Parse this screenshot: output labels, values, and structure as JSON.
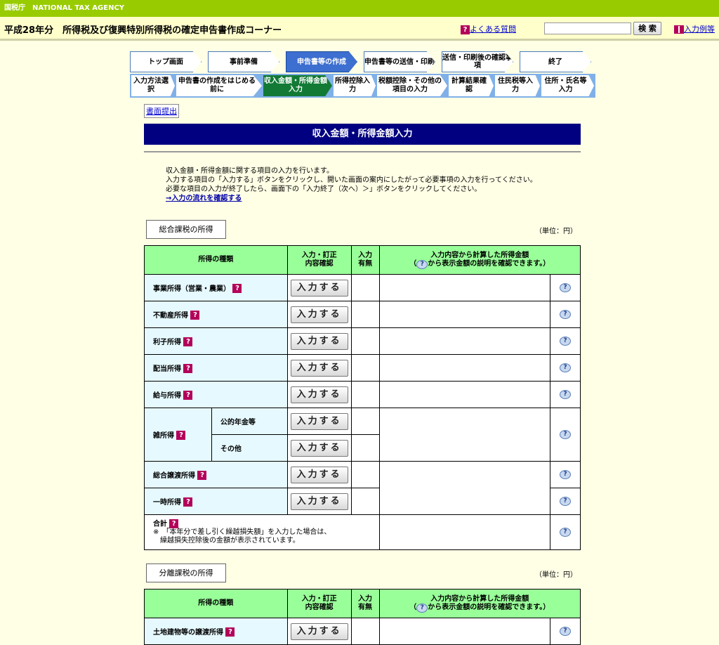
{
  "header": {
    "agency": "国税庁　NATIONAL TAX AGENCY",
    "title": "平成28年分　所得税及び復興特別所得税の確定申告書作成コーナー",
    "faq_label": "よくある質問",
    "search_button": "検 索",
    "search_value": "",
    "example_label": "入力例等"
  },
  "steps": [
    "トップ画面",
    "事前準備",
    "申告書等の作成",
    "申告書等の送信・印刷",
    "送信・印刷後の確認事項",
    "終了"
  ],
  "substeps": [
    "入力方法選択",
    "申告書の作成をはじめる前に",
    "収入金額・所得金額入力",
    "所得控除入力",
    "税額控除・その他の項目の入力",
    "計算結果確認",
    "住民税等入力",
    "住所・氏名等入力"
  ],
  "paper_button": "書面提出",
  "heading": "収入金額・所得金額入力",
  "intro": {
    "line1": "収入金額・所得金額に関する項目の入力を行います。",
    "line2": "入力する項目の「入力する」ボタンをクリックし、開いた画面の案内にしたがって必要事項の入力を行ってください。",
    "line3": "必要な項目の入力が終了したら、画面下の「入力終了（次へ）＞」ボタンをクリックしてください。",
    "link": "→入力の流れを確認する"
  },
  "section1": {
    "title": "総合課税の所得",
    "unit": "（単位：円）",
    "headers": {
      "type": "所得の種類",
      "confirm": "入力・訂正\n内容確認",
      "has_input": "入力\n有無",
      "amount": "入力内容から計算した所得金額\n（  から表示金額の説明を確認できます。）"
    },
    "rows": {
      "business": "事業所得（営業・農業）",
      "real_estate": "不動産所得",
      "interest": "利子所得",
      "dividend": "配当所得",
      "salary": "給与所得",
      "misc": "雑所得",
      "misc_pension": "公的年金等",
      "misc_other": "その他",
      "transfer": "総合譲渡所得",
      "temporary": "一時所得",
      "total": "合計",
      "total_note1": "※　「本年分で差し引く繰越損失額」を入力した場合は、",
      "total_note2": "繰越損失控除後の金額が表示されています。"
    },
    "input_button": "入力する"
  },
  "section2": {
    "title": "分離課税の所得",
    "unit": "（単位：円）",
    "rows": {
      "land": "土地建物等の譲渡所得"
    }
  }
}
